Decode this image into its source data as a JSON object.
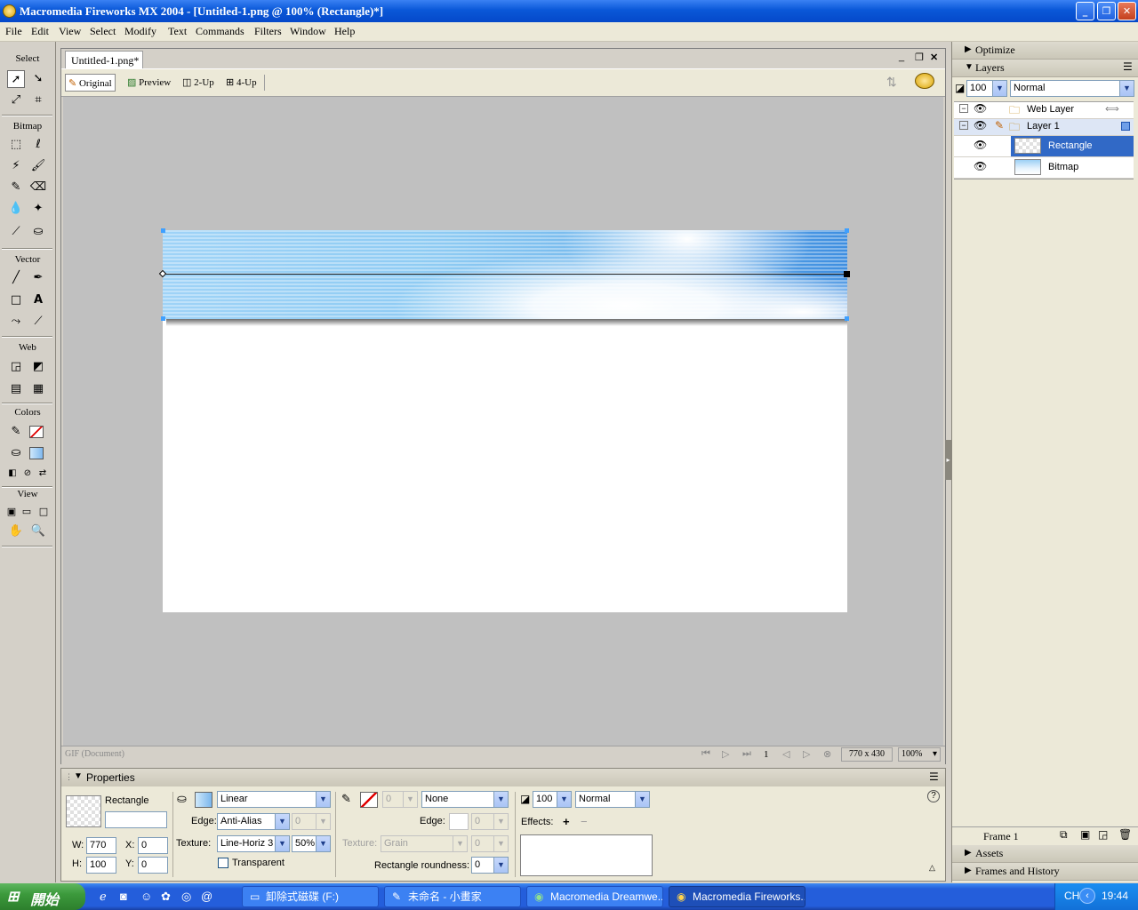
{
  "window": {
    "title": "Macromedia Fireworks MX 2004 - [Untitled-1.png @ 100% (Rectangle)*]",
    "controls": {
      "minimize": "_",
      "restore": "❐",
      "close": "✕"
    }
  },
  "menu": [
    "File",
    "Edit",
    "View",
    "Select",
    "Modify",
    "Text",
    "Commands",
    "Filters",
    "Window",
    "Help"
  ],
  "tools": {
    "sections": {
      "select": "Select",
      "bitmap": "Bitmap",
      "vector": "Vector",
      "web": "Web",
      "colors": "Colors",
      "view": "View"
    }
  },
  "document": {
    "tab": "Untitled-1.png*",
    "views": {
      "original": "Original",
      "preview": "Preview",
      "two_up": "2-Up",
      "four_up": "4-Up"
    },
    "status_format": "GIF (Document)",
    "frame_number": "1",
    "size": "770 x 430",
    "zoom": "100%",
    "colors": {
      "canvas_bg": "#c0c0c0",
      "selection_handle": "#3fa0ff"
    }
  },
  "properties": {
    "title": "Properties",
    "object_type": "Rectangle",
    "object_name": "",
    "width_label": "W:",
    "width": "770",
    "height_label": "H:",
    "height": "100",
    "x_label": "X:",
    "x": "0",
    "y_label": "Y:",
    "y": "0",
    "fill_type": "Linear",
    "edge_label": "Edge:",
    "fill_edge": "Anti-Alias",
    "fill_edge_feather": "0",
    "texture_label": "Texture:",
    "fill_texture": "Line-Horiz 3",
    "fill_texture_amount": "50%",
    "transparent_label": "Transparent",
    "stroke_size": "0",
    "stroke_type": "None",
    "stroke_edge_label": "Edge:",
    "stroke_edge": "0",
    "stroke_texture_label": "Texture:",
    "stroke_texture": "Grain",
    "stroke_texture_amount": "0",
    "roundness_label": "Rectangle roundness:",
    "roundness": "0",
    "opacity": "100",
    "blend_mode": "Normal",
    "effects_label": "Effects:",
    "help": "?"
  },
  "panels": {
    "optimize": "Optimize",
    "layers": "Layers",
    "layers_opacity": "100",
    "layers_blend": "Normal",
    "layer_rows": [
      {
        "name": "Web Layer"
      },
      {
        "name": "Layer 1"
      },
      {
        "name": "Rectangle"
      },
      {
        "name": "Bitmap"
      }
    ],
    "frame_label": "Frame 1",
    "assets": "Assets",
    "frames_history": "Frames and History"
  },
  "taskbar": {
    "start": "開始",
    "items": [
      {
        "label": "卸除式磁碟 (F:)"
      },
      {
        "label": "未命名 - 小畫家"
      },
      {
        "label": "Macromedia Dreamwe..."
      },
      {
        "label": "Macromedia Fireworks..."
      }
    ],
    "lang": "CH",
    "clock": "19:44"
  }
}
